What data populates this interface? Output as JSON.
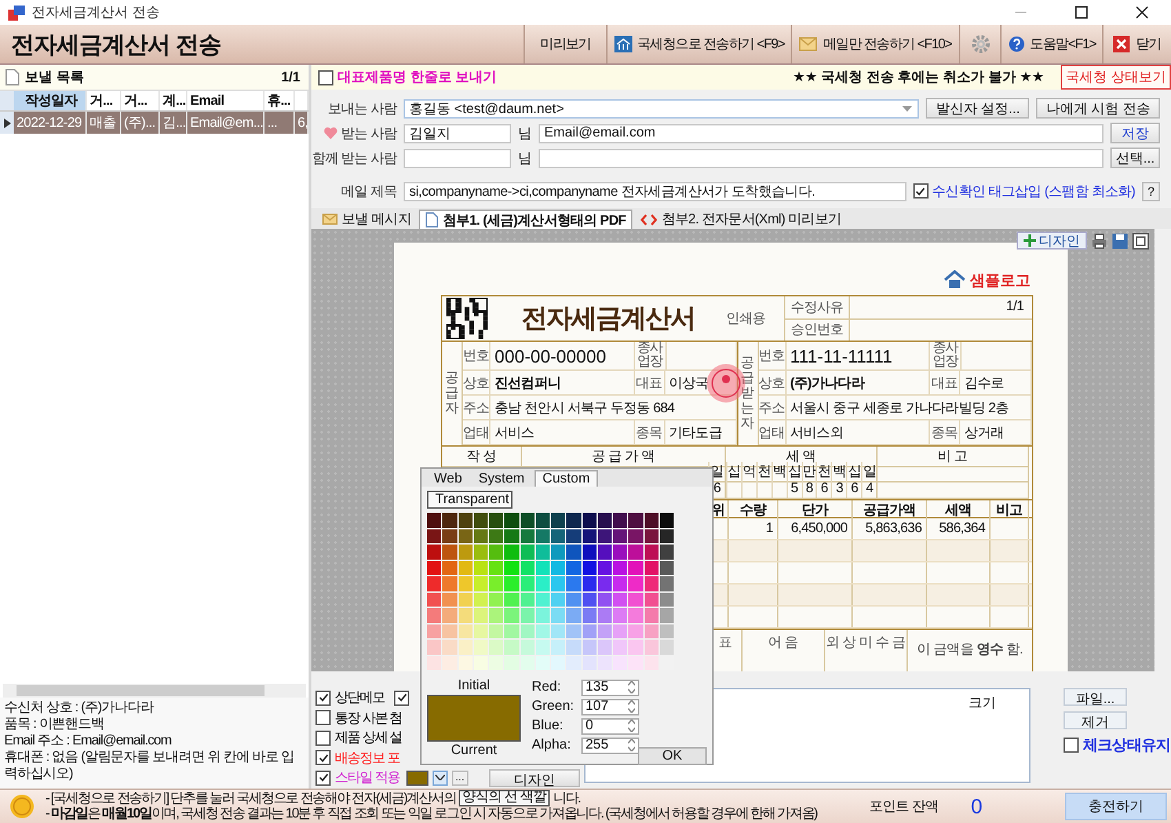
{
  "window": {
    "title": "전자세금계산서 전송"
  },
  "header": {
    "title": "전자세금계산서 전송",
    "buttons": [
      {
        "kind": "plain",
        "label": "미리보기"
      },
      {
        "kind": "send",
        "label": "국세청으로 전송하기 <F9>"
      },
      {
        "kind": "mail",
        "label": "메일만 전송하기 <F10>"
      },
      {
        "kind": "settings"
      },
      {
        "kind": "help",
        "label": "도움말<F1>"
      },
      {
        "kind": "exit",
        "label": "닫기"
      }
    ]
  },
  "send_list": {
    "title": "보낼 목록",
    "count": "1/1",
    "columns": [
      "작성일자",
      "거...",
      "거...",
      "계...",
      "Email",
      "휴..."
    ],
    "rows": [
      {
        "selected": true,
        "cells": [
          "2022-12-29",
          "매출",
          "(주)...",
          "김...",
          "Email@em...",
          "...",
          "6,"
        ]
      }
    ],
    "details": [
      "수신처 상호 : (주)가나다라",
      "품목 : 이쁜핸드백",
      "Email 주소 : Email@email.com",
      "휴대폰 : 없음 (알림문자를 보내려면 위 칸에 바로 입력하십시오)"
    ]
  },
  "options_bar": {
    "one_line_checkbox": {
      "label": "대표제품명 한줄로 보내기",
      "checked": false
    },
    "notice": "★★ 국세청 전송 후에는 취소가 불가 ★★",
    "status_button": "국세청 상태보기"
  },
  "mail_form": {
    "sender": {
      "label": "보내는 사람",
      "value": "홍길동 <test@daum.net>",
      "buttons": [
        "발신자 설정...",
        "나에게 시험 전송"
      ]
    },
    "recipient": {
      "label": "받는 사람",
      "name": "김일지",
      "suffix": "님",
      "email": "Email@email.com",
      "button": "저장"
    },
    "cc": {
      "label": "함께 받는 사람",
      "suffix": "님",
      "button": "선택..."
    },
    "subject": {
      "label": "메일 제목",
      "value": "si,companyname->ci,companyname 전자세금계산서가 도착했습니다.",
      "tag_checkbox": {
        "label": "수신확인 태그삽입 (스팸함 최소화)",
        "checked": true
      },
      "help_button": "?"
    }
  },
  "tabs": [
    {
      "kind": "message",
      "label": "보낼 메시지",
      "selected": false
    },
    {
      "kind": "pdf",
      "label": "첨부1. (세금)계산서형태의 PDF",
      "selected": true
    },
    {
      "kind": "xml",
      "label": "첨부2. 전자문서(Xml) 미리보기",
      "selected": false
    }
  ],
  "preview": {
    "design_button": "디자인",
    "logo": "샘플로고",
    "invoice": {
      "title": "전자세금계산서",
      "print_label": "인쇄용",
      "meta": [
        {
          "label": "수정사유",
          "value": "1/1"
        },
        {
          "label": "승인번호"
        }
      ],
      "parties": [
        {
          "side": "공급자",
          "reg_label": "번호",
          "reg": "000-00-00000",
          "branch_label": "종사업장",
          "name_label": "상호",
          "name": "진선컴퍼니",
          "rep_label": "대표",
          "rep": "이상국",
          "addr_label": "주소",
          "addr": "충남 천안시 서북구 두정동 684",
          "biz_label": "업태",
          "biz": "서비스",
          "item_label": "종목",
          "item": "기타도급",
          "stamp": true
        },
        {
          "side": "공급받는자",
          "reg_label": "번호",
          "reg": "111-11-11111",
          "branch_label": "종사업장",
          "name_label": "상호",
          "name": "(주)가나다라",
          "rep_label": "대표",
          "rep": "김수로",
          "addr_label": "주소",
          "addr": "서울시 중구 세종로 가나다라빌딩 2층",
          "biz_label": "업태",
          "biz": "서비스외",
          "item_label": "종목",
          "item": "상거래",
          "stamp": false
        }
      ],
      "amounts": {
        "headers": [
          "작 성",
          "공 급 가 액",
          "세 액",
          "비 고"
        ],
        "supply_last_digit": {
          "label": "일",
          "value": "6"
        },
        "tax_digits": [
          {
            "label": "십"
          },
          {
            "label": "억"
          },
          {
            "label": "천"
          },
          {
            "label": "백"
          },
          {
            "label": "십",
            "value": "5"
          },
          {
            "label": "만",
            "value": "8"
          },
          {
            "label": "천",
            "value": "6"
          },
          {
            "label": "백",
            "value": "3"
          },
          {
            "label": "십",
            "value": "6"
          },
          {
            "label": "일",
            "value": "4"
          }
        ]
      },
      "items": {
        "columns": [
          "위",
          "수량",
          "단가",
          "공급가액",
          "세액",
          "비고"
        ],
        "rows": [
          {
            "qty": "1",
            "price": "6,450,000",
            "supply": "5,863,636",
            "tax": "586,364"
          }
        ]
      },
      "payment": {
        "labels": [
          "표",
          "어 음",
          "외 상 미 수 금"
        ],
        "receipt": "이 금액을 **영수** 함."
      }
    }
  },
  "color_picker": {
    "tabs": [
      {
        "label": "Web",
        "selected": false
      },
      {
        "label": "System",
        "selected": false
      },
      {
        "label": "Custom",
        "selected": true
      }
    ],
    "transparent": "Transparent",
    "initial_label": "Initial",
    "current_label": "Current",
    "channels": [
      {
        "label": "Red:",
        "value": "135"
      },
      {
        "label": "Green:",
        "value": "107"
      },
      {
        "label": "Blue:",
        "value": "0"
      },
      {
        "label": "Alpha:",
        "value": "255"
      }
    ],
    "ok": "OK"
  },
  "print_options": {
    "checkboxes": [
      {
        "label": "상단메모",
        "checked": true,
        "color": "#000000"
      },
      {
        "label": "통장 사본 첨",
        "checked": false,
        "color": "#000000"
      },
      {
        "label": "제품 상세 설",
        "checked": false,
        "color": "#000000"
      },
      {
        "label": "배송정보 포",
        "checked": true,
        "color": "#ff2020"
      },
      {
        "label": "스타일 적용",
        "checked": true,
        "color": "#d020d0"
      }
    ],
    "extra_checkbox": {
      "checked": true
    },
    "more_button": "...",
    "design_button": "디자인"
  },
  "attachments": {
    "size_column": "크기",
    "buttons": [
      "파일...",
      "제거"
    ],
    "keep_checkbox": {
      "label": "체크상태유지",
      "checked": false
    }
  },
  "footer": {
    "line_1": "- [국세청으로 전송하기] 단추를 눌러 국세청으로 전송해야 전자(세금)계산서의",
    "tooltip": "양식의 선 색깔",
    "line_1_end": "니다.",
    "line_2": "- **마감일**은 **매월10일**이며, 국세청 전송 결과는 10분 후 직접 조회 또는 익일 로그인 시 자동으로 가져옵니다. (국세청에서 허용할 경우에 한해 가져옴)",
    "points_label": "포인트 잔액",
    "points": "0",
    "charge_button": "충전하기"
  }
}
